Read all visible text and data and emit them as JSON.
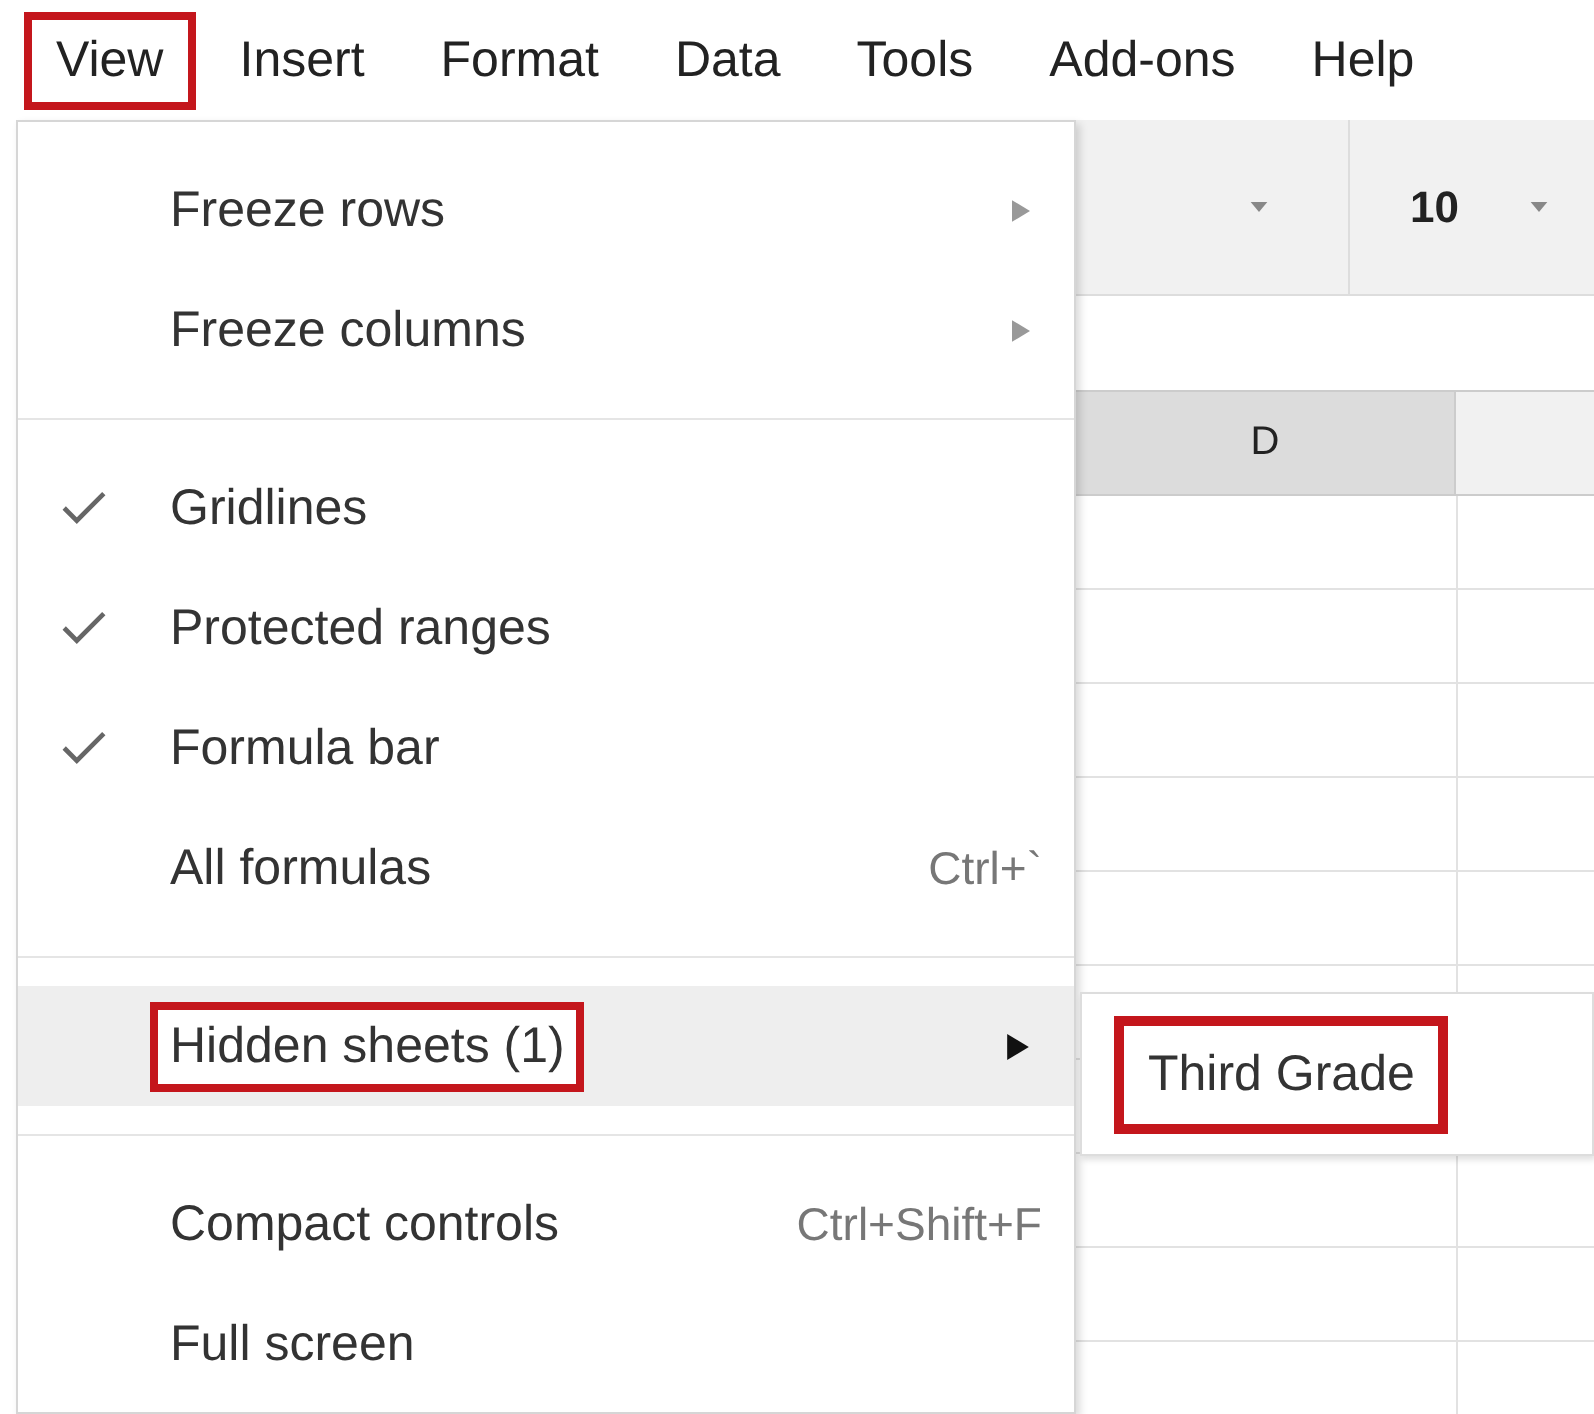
{
  "menubar": [
    {
      "label": "View",
      "highlighted": true
    },
    {
      "label": "Insert",
      "highlighted": false
    },
    {
      "label": "Format",
      "highlighted": false
    },
    {
      "label": "Data",
      "highlighted": false
    },
    {
      "label": "Tools",
      "highlighted": false
    },
    {
      "label": "Add-ons",
      "highlighted": false
    },
    {
      "label": "Help",
      "highlighted": false
    }
  ],
  "toolbar": {
    "font_size": "10"
  },
  "sheet": {
    "column_header": "D"
  },
  "view_menu": {
    "items": [
      {
        "kind": "item",
        "label": "Freeze rows",
        "submenu": true,
        "checked": false,
        "hovered": false,
        "highlighted": false
      },
      {
        "kind": "item",
        "label": "Freeze columns",
        "submenu": true,
        "checked": false,
        "hovered": false,
        "highlighted": false
      },
      {
        "kind": "separator"
      },
      {
        "kind": "item",
        "label": "Gridlines",
        "submenu": false,
        "checked": true,
        "hovered": false,
        "highlighted": false
      },
      {
        "kind": "item",
        "label": "Protected ranges",
        "submenu": false,
        "checked": true,
        "hovered": false,
        "highlighted": false
      },
      {
        "kind": "item",
        "label": "Formula bar",
        "submenu": false,
        "checked": true,
        "hovered": false,
        "highlighted": false
      },
      {
        "kind": "item",
        "label": "All formulas",
        "shortcut": "Ctrl+`",
        "submenu": false,
        "checked": false,
        "hovered": false,
        "highlighted": false
      },
      {
        "kind": "separator"
      },
      {
        "kind": "item",
        "label": "Hidden sheets (1)",
        "submenu": true,
        "checked": false,
        "hovered": true,
        "highlighted": true
      },
      {
        "kind": "separator"
      },
      {
        "kind": "item",
        "label": "Compact controls",
        "shortcut": "Ctrl+Shift+F",
        "submenu": false,
        "checked": false,
        "hovered": false,
        "highlighted": false
      },
      {
        "kind": "item",
        "label": "Full screen",
        "submenu": false,
        "checked": false,
        "hovered": false,
        "highlighted": false
      }
    ]
  },
  "hidden_sheets_submenu": {
    "items": [
      {
        "label": "Third Grade",
        "highlighted": true
      }
    ]
  }
}
